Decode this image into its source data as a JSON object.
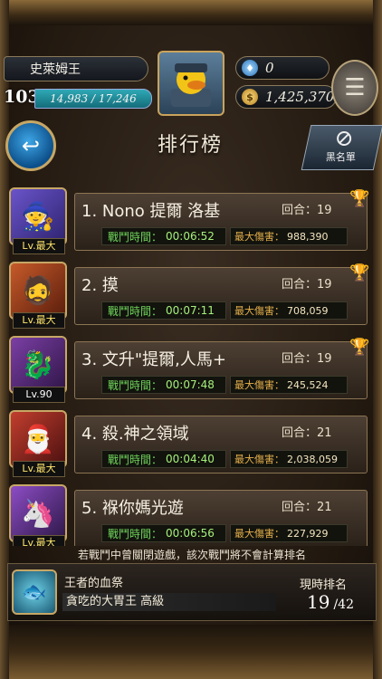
{
  "player": {
    "name": "史萊姆王",
    "level": "103",
    "exp": "14,983 / 17,246",
    "gems": "0",
    "gold": "1,425,370"
  },
  "header": {
    "title": "排行榜",
    "blacklist_label": "黑名單"
  },
  "rankings": [
    {
      "rank_name": "1. Nono 提爾 洛基",
      "rounds": "回合：19",
      "level": "Lv.最大",
      "time_label": "戰鬥時間：",
      "time": "00:06:52",
      "dmg_label": "最大傷害：",
      "dmg": "988,390",
      "trophy": "gold"
    },
    {
      "rank_name": "2. 摸",
      "rounds": "回合：19",
      "level": "Lv.最大",
      "time_label": "戰鬥時間：",
      "time": "00:07:11",
      "dmg_label": "最大傷害：",
      "dmg": "708,059",
      "trophy": "silver"
    },
    {
      "rank_name": "3. 文升\"提爾,人馬+",
      "rounds": "回合：19",
      "level": "Lv.90",
      "time_label": "戰鬥時間：",
      "time": "00:07:48",
      "dmg_label": "最大傷害：",
      "dmg": "245,524",
      "trophy": "bronze"
    },
    {
      "rank_name": "4. 殺.神之領域",
      "rounds": "回合：21",
      "level": "Lv.最大",
      "time_label": "戰鬥時間：",
      "time": "00:04:40",
      "dmg_label": "最大傷害：",
      "dmg": "2,038,059",
      "trophy": ""
    },
    {
      "rank_name": "5. 褓你媽光遊",
      "rounds": "回合：21",
      "level": "Lv.最大",
      "time_label": "戰鬥時間：",
      "time": "00:06:56",
      "dmg_label": "最大傷害：",
      "dmg": "227,929",
      "trophy": ""
    }
  ],
  "notice": "若戰鬥中曾關閉遊戲，該次戰鬥將不會計算排名",
  "event": {
    "name": "王者的血祭",
    "boss": "貪吃的大胃王 高級",
    "rank_label": "現時排名",
    "current_rank": "19",
    "total": "/42"
  },
  "colors": {
    "accent_green": "#6fd35a",
    "accent_gold": "#e6b04c",
    "frame_gold": "#c7a765"
  }
}
